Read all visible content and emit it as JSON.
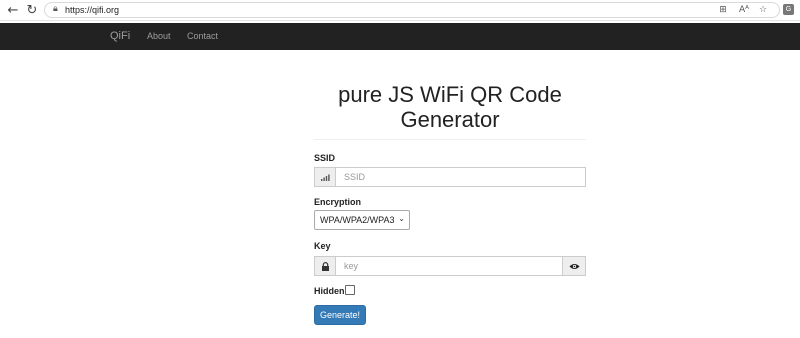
{
  "browser": {
    "url": "https://qifi.org",
    "profile_initial": "G"
  },
  "navbar": {
    "brand": "QiFi",
    "links": [
      "About",
      "Contact"
    ]
  },
  "form": {
    "title": "pure JS WiFi QR Code Generator",
    "ssid_label": "SSID",
    "ssid_placeholder": "SSID",
    "encryption_label": "Encryption",
    "encryption_value": "WPA/WPA2/WPA3",
    "key_label": "Key",
    "key_placeholder": "key",
    "hidden_label": "Hidden",
    "hidden_checked": false,
    "submit_label": "Generate!"
  },
  "colors": {
    "navbar_bg": "#222222",
    "button_primary": "#337ab7"
  }
}
